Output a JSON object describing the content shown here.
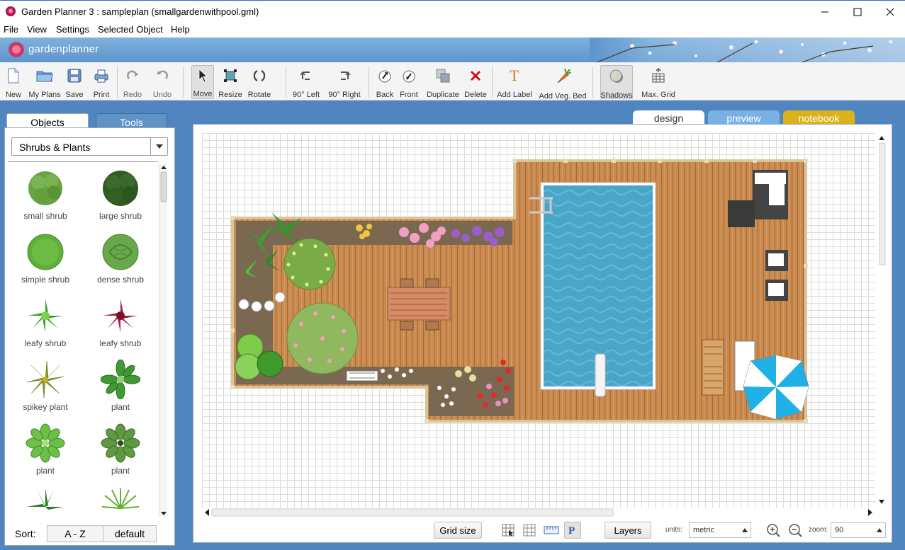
{
  "window": {
    "title": "Garden Planner 3 : sampleplan (smallgardenwithpool.gml)",
    "minimize_label": "—",
    "maximize_label": "☐",
    "close_label": "✕"
  },
  "menu": [
    "File",
    "View",
    "Settings",
    "Selected Object",
    "Help"
  ],
  "brand": "gardenplanner",
  "toolbar": [
    {
      "label": "New",
      "icon": "new-file-icon"
    },
    {
      "label": "My Plans",
      "icon": "folder-icon"
    },
    {
      "label": "Save",
      "icon": "save-icon"
    },
    {
      "label": "Print",
      "icon": "print-icon"
    },
    {
      "label": "Redo",
      "icon": "redo-icon"
    },
    {
      "label": "Undo",
      "icon": "undo-icon"
    },
    {
      "label": "Move",
      "icon": "cursor-icon"
    },
    {
      "label": "Resize",
      "icon": "resize-icon"
    },
    {
      "label": "Rotate",
      "icon": "rotate-icon"
    },
    {
      "label": "90° Left",
      "icon": "rotate-left-icon"
    },
    {
      "label": "90° Right",
      "icon": "rotate-right-icon"
    },
    {
      "label": "Back",
      "icon": "send-back-icon"
    },
    {
      "label": "Front",
      "icon": "bring-front-icon"
    },
    {
      "label": "Duplicate",
      "icon": "duplicate-icon"
    },
    {
      "label": "Delete",
      "icon": "delete-icon"
    },
    {
      "label": "Add Label",
      "icon": "text-icon"
    },
    {
      "label": "Add Veg. Bed",
      "icon": "carrot-icon"
    },
    {
      "label": "Shadows",
      "icon": "shadow-icon"
    },
    {
      "label": "Max. Grid",
      "icon": "grid-max-icon"
    }
  ],
  "left_panel": {
    "tabs": [
      "Objects",
      "Tools"
    ],
    "category": "Shrubs & Plants",
    "objects": [
      {
        "name": "small shrub",
        "icon": "small-shrub-icon"
      },
      {
        "name": "large shrub",
        "icon": "large-shrub-icon"
      },
      {
        "name": "simple shrub",
        "icon": "simple-shrub-icon"
      },
      {
        "name": "dense shrub",
        "icon": "dense-shrub-icon"
      },
      {
        "name": "leafy shrub",
        "icon": "leafy-shrub-green-icon"
      },
      {
        "name": "leafy shrub",
        "icon": "leafy-shrub-red-icon"
      },
      {
        "name": "spikey plant",
        "icon": "spikey-plant-icon"
      },
      {
        "name": "plant",
        "icon": "plant-icon"
      },
      {
        "name": "plant",
        "icon": "plant-light-icon"
      },
      {
        "name": "plant",
        "icon": "plant-dotted-icon"
      }
    ],
    "sort_label": "Sort:",
    "sort_options": [
      "A - Z",
      "default"
    ]
  },
  "view_tabs": [
    "design",
    "preview",
    "notebook"
  ],
  "status": {
    "grid_size": "Grid size",
    "layers": "Layers",
    "units_label": "units:",
    "units_value": "metric",
    "zoom_label": "zoom:",
    "zoom_value": "90"
  },
  "colors": {
    "accent_blue": "#4f86bf",
    "deck": "#c98a4f",
    "pool": "#4aa6c9",
    "notebook_tab": "#dcb21a",
    "preview_tab": "#7ab1e3"
  }
}
